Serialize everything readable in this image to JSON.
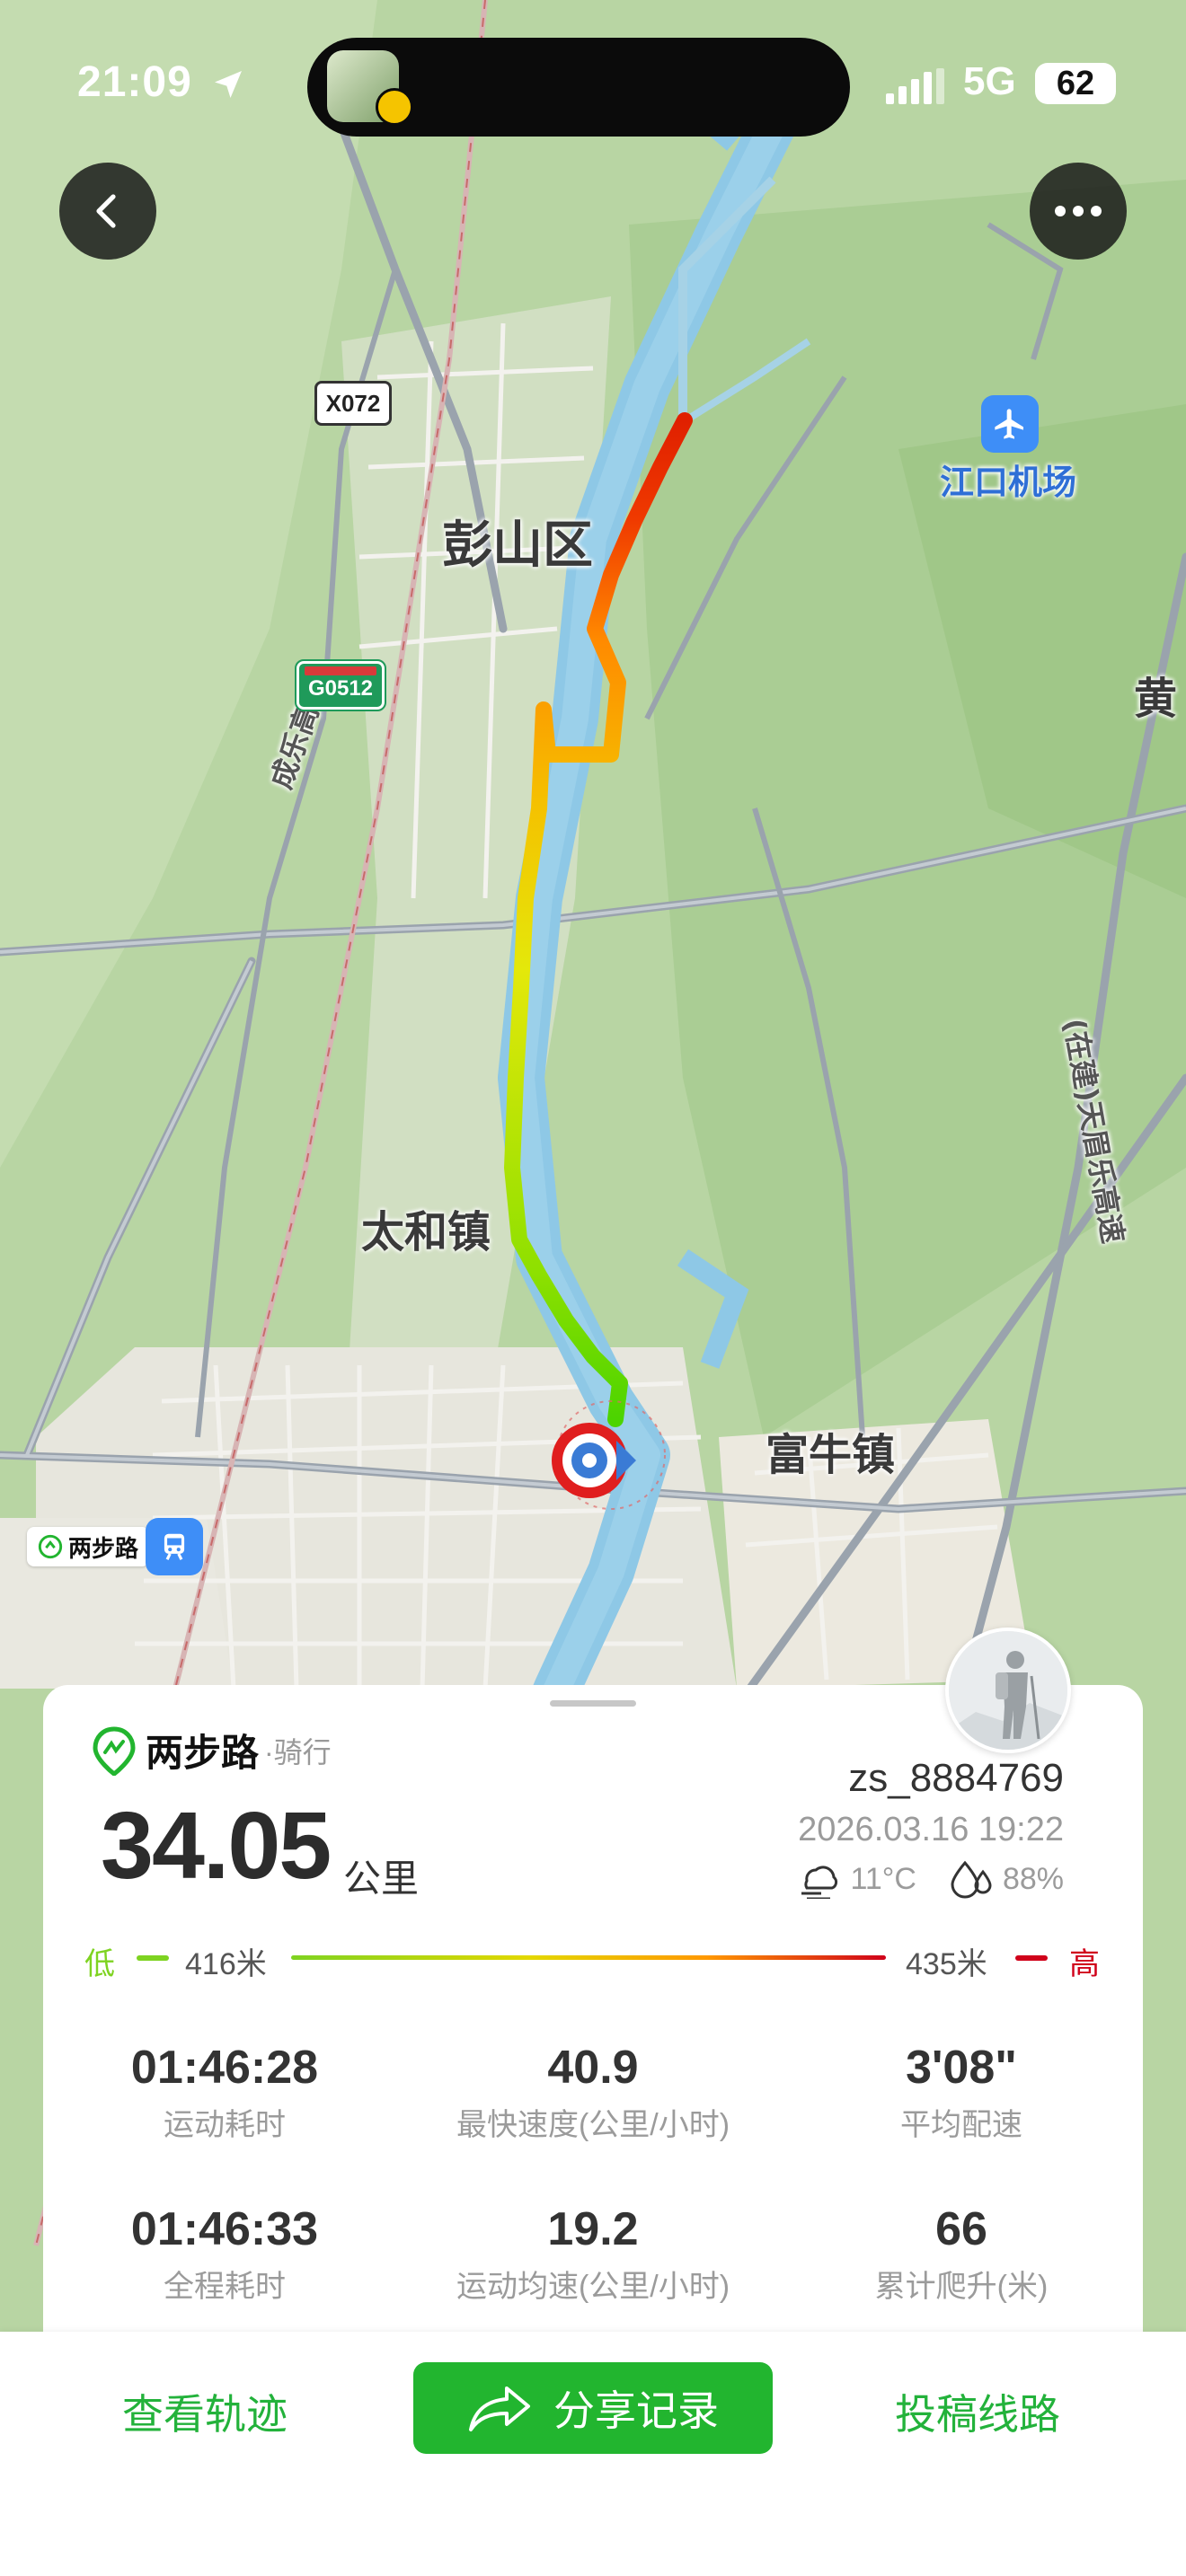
{
  "status_bar": {
    "time": "21:09",
    "network": "5G",
    "battery": "62"
  },
  "map": {
    "labels": {
      "airport": "江口机场",
      "district": "彭山区",
      "town_taihe": "太和镇",
      "town_funiu": "富牛镇",
      "huang": "黄",
      "expressway_chengle": "成乐高速",
      "expressway_tianmei": "(在建)天眉乐高速"
    },
    "road_shields": {
      "x072": "X072",
      "g0512": "G0512"
    },
    "watermark": "两步路"
  },
  "summary": {
    "brand": "两步路",
    "activity": "·骑行",
    "distance": "34.05",
    "distance_unit": "公里",
    "username": "zs_8884769",
    "datetime": "2026.03.16 19:22",
    "temperature": "11°C",
    "humidity": "88%",
    "elevation": {
      "low_label": "低",
      "low_value": "416米",
      "high_value": "435米",
      "high_label": "高"
    },
    "stats": [
      {
        "value": "01:46:28",
        "label": "运动耗时"
      },
      {
        "value": "40.9",
        "label": "最快速度(公里/小时)"
      },
      {
        "value": "3'08\"",
        "label": "平均配速"
      },
      {
        "value": "01:46:33",
        "label": "全程耗时"
      },
      {
        "value": "19.2",
        "label": "运动均速(公里/小时)"
      },
      {
        "value": "66",
        "label": "累计爬升(米)"
      }
    ]
  },
  "bottom_bar": {
    "view_track": "查看轨迹",
    "share": "分享记录",
    "submit_route": "投稿线路"
  },
  "colors": {
    "accent": "#22b52f",
    "elevation_low": "#7ed321",
    "elevation_high": "#d0021b"
  }
}
